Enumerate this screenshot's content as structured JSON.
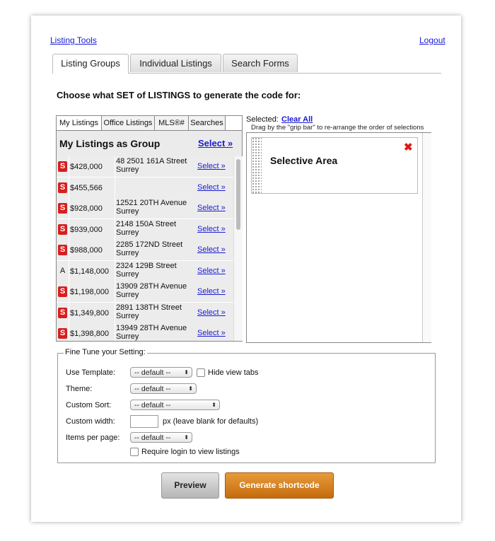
{
  "header": {
    "left_link": "Listing Tools",
    "right_link": "Logout"
  },
  "tabs": [
    {
      "label": "Listing Groups",
      "active": true
    },
    {
      "label": "Individual Listings",
      "active": false
    },
    {
      "label": "Search Forms",
      "active": false
    }
  ],
  "heading": "Choose what SET of LISTINGS to generate the code for:",
  "source_tabs": [
    "My Listings",
    "Office Listings",
    "MLS®#",
    "Searches"
  ],
  "group": {
    "title": "My Listings as Group",
    "select_label": "Select »"
  },
  "listings": [
    {
      "badge": "S",
      "price": "$428,000",
      "address": "48 2501 161A Street\nSurrey",
      "select": "Select »"
    },
    {
      "badge": "S",
      "price": "$455,566",
      "address": "",
      "select": "Select »"
    },
    {
      "badge": "S",
      "price": "$928,000",
      "address": "12521 20TH Avenue\nSurrey",
      "select": "Select »"
    },
    {
      "badge": "S",
      "price": "$939,000",
      "address": "2148 150A Street\nSurrey",
      "select": "Select »"
    },
    {
      "badge": "S",
      "price": "$988,000",
      "address": "2285 172ND Street\nSurrey",
      "select": "Select »"
    },
    {
      "badge": "A",
      "price": "$1,148,000",
      "address": "2324 129B Street\nSurrey",
      "select": "Select »"
    },
    {
      "badge": "S",
      "price": "$1,198,000",
      "address": "13909 28TH Avenue\nSurrey",
      "select": "Select »"
    },
    {
      "badge": "S",
      "price": "$1,349,800",
      "address": "2891 138TH Street\nSurrey",
      "select": "Select »"
    },
    {
      "badge": "S",
      "price": "$1,398,800",
      "address": "13949 28TH Avenue\nSurrey",
      "select": "Select »"
    }
  ],
  "selected": {
    "label": "Selected:",
    "clear_all": "Clear All",
    "hint": "Drag by the \"grip bar\" to re-arrange the order of selections",
    "item_title": "Selective Area",
    "remove_icon": "✖"
  },
  "fine_tune": {
    "legend": "Fine Tune your Setting:",
    "use_template_label": "Use Template:",
    "use_template_value": "-- default --",
    "hide_tabs_label": "Hide view tabs",
    "theme_label": "Theme:",
    "theme_value": "-- default --",
    "sort_label": "Custom Sort:",
    "sort_value": "-- default --",
    "width_label": "Custom width:",
    "width_suffix": "px (leave blank for defaults)",
    "per_page_label": "Items per page:",
    "per_page_value": "-- default --",
    "require_login_label": "Require login to view listings",
    "arrow": "⬍"
  },
  "buttons": {
    "preview": "Preview",
    "generate": "Generate shortcode"
  },
  "colors": {
    "badge_sold": "#d91e1e",
    "link": "#1a1ad6",
    "generate_button": "#d17a1e"
  }
}
